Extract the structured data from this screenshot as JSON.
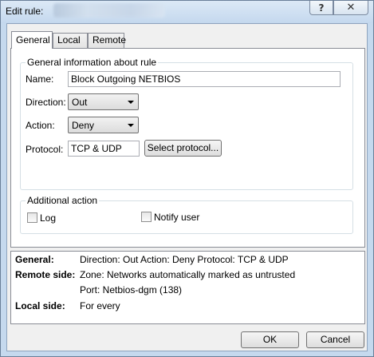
{
  "window": {
    "title": "Edit rule:",
    "help_glyph": "?",
    "close_glyph": "✕"
  },
  "tabs": [
    {
      "label": "General"
    },
    {
      "label": "Local"
    },
    {
      "label": "Remote"
    }
  ],
  "general_group": {
    "title": "General information about rule",
    "name_label": "Name:",
    "name_value": "Block Outgoing NETBIOS",
    "direction_label": "Direction:",
    "direction_value": "Out",
    "action_label": "Action:",
    "action_value": "Deny",
    "protocol_label": "Protocol:",
    "protocol_value": "TCP & UDP",
    "select_protocol_label": "Select protocol..."
  },
  "additional_group": {
    "title": "Additional action",
    "log_label": "Log",
    "log_checked": false,
    "notify_label": "Notify user",
    "notify_checked": false
  },
  "summary": {
    "general_key": "General:",
    "general_value": "Direction: Out   Action: Deny   Protocol: TCP & UDP",
    "remote_key": "Remote side:",
    "remote_value_1": "Zone: Networks automatically marked as untrusted",
    "remote_value_2": "Port: Netbios-dgm (138)",
    "local_key": "Local side:",
    "local_value": "For every"
  },
  "buttons": {
    "ok": "OK",
    "cancel": "Cancel"
  }
}
